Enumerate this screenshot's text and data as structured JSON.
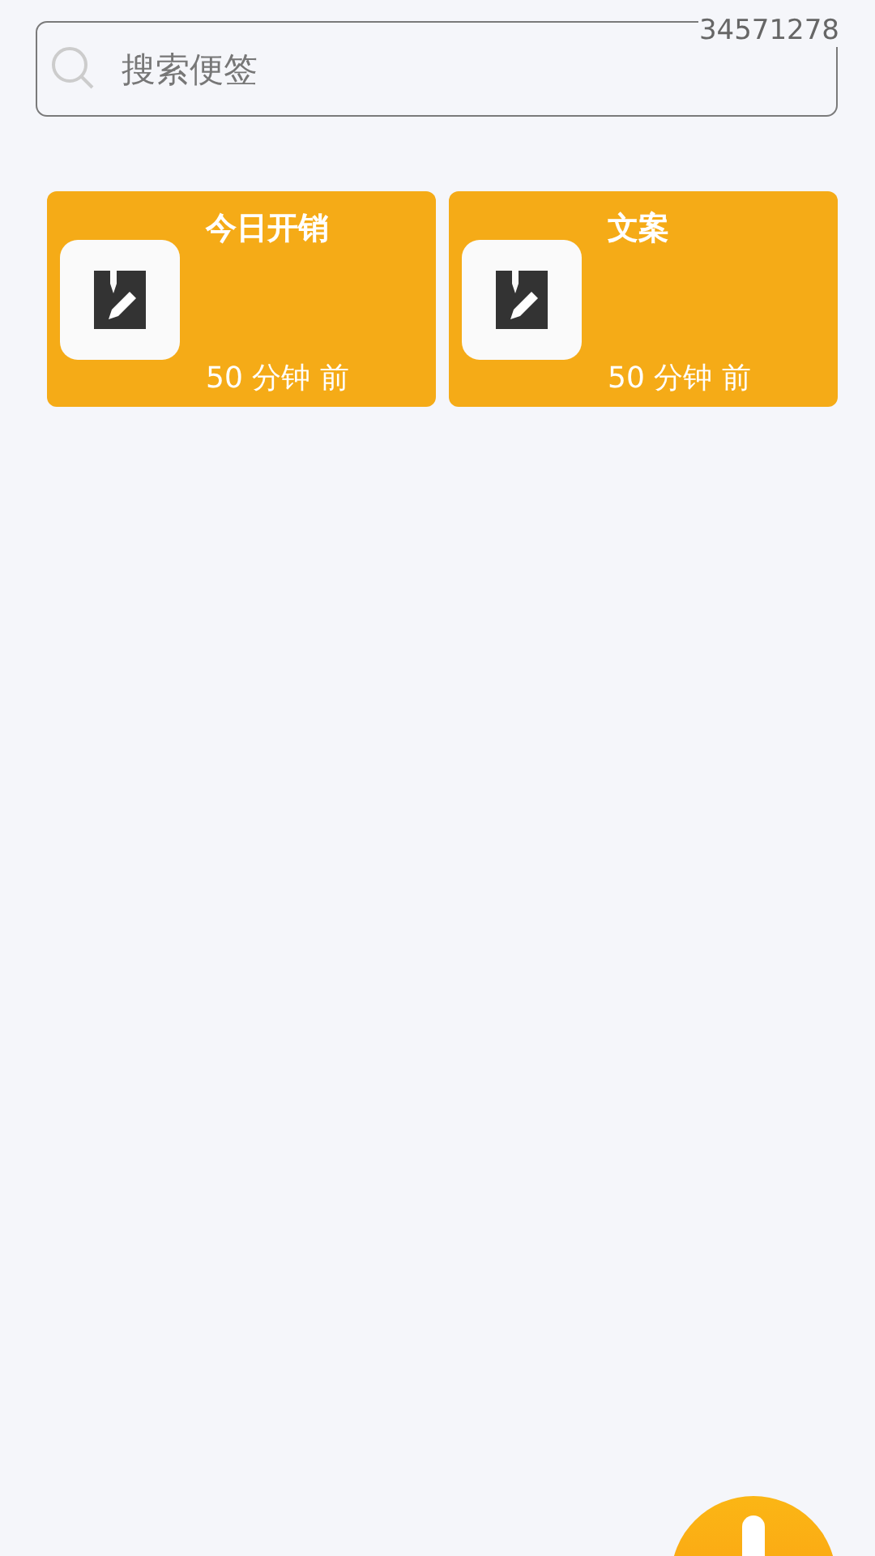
{
  "search": {
    "placeholder": "搜索便签"
  },
  "overlay_text": "34571278",
  "notes": [
    {
      "title": "今日开销",
      "time": "50 分钟 前"
    },
    {
      "title": "文案",
      "time": "50 分钟 前"
    }
  ]
}
